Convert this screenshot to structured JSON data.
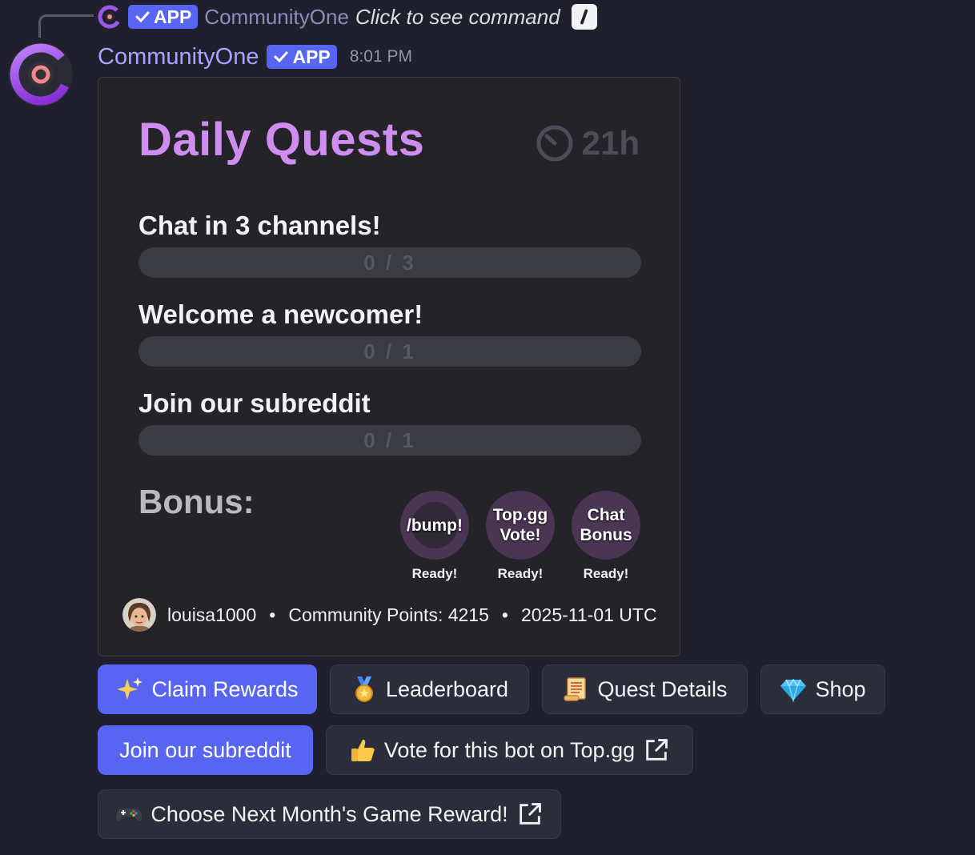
{
  "reply": {
    "app_badge": "APP",
    "name": "CommunityOne",
    "command": "Click to see command"
  },
  "message": {
    "author": "CommunityOne",
    "app_badge": "APP",
    "time": "8:01 PM"
  },
  "quests": {
    "title": "Daily Quests",
    "timer": "21h",
    "items": [
      {
        "name": "Chat in 3 channels!",
        "progress": "0 / 3",
        "fraction": 0
      },
      {
        "name": "Welcome a newcomer!",
        "progress": "0 / 1",
        "fraction": 0
      },
      {
        "name": "Join our subreddit",
        "progress": "0 / 1",
        "fraction": 0
      }
    ],
    "bonus_label": "Bonus:",
    "bonuses": [
      {
        "line1": "/bump!",
        "line2": "",
        "status": "Ready!"
      },
      {
        "line1": "Top.gg",
        "line2": "Vote!",
        "status": "Ready!"
      },
      {
        "line1": "Chat",
        "line2": "Bonus",
        "status": "Ready!"
      }
    ],
    "footer": {
      "username": "louisa1000",
      "points": "Community Points: 4215",
      "date": "2025-11-01 UTC",
      "separator": "•"
    }
  },
  "buttons": {
    "claim": "Claim Rewards",
    "leaderboard": "Leaderboard",
    "quest_details": "Quest Details",
    "shop": "Shop",
    "subreddit": "Join our subreddit",
    "vote": "Vote for this bot on Top.gg",
    "game": "Choose Next Month's Game Reward!"
  },
  "colors": {
    "accent": "#5865f2",
    "title": "#d08df0",
    "author": "#a9a4ff"
  },
  "icons": {
    "claim": "sparkles-icon",
    "leaderboard": "medal-icon",
    "quest_details": "scroll-icon",
    "shop": "gem-icon",
    "vote": "thumbs-up-icon",
    "game": "game-controller-icon",
    "external": "external-link-icon"
  }
}
